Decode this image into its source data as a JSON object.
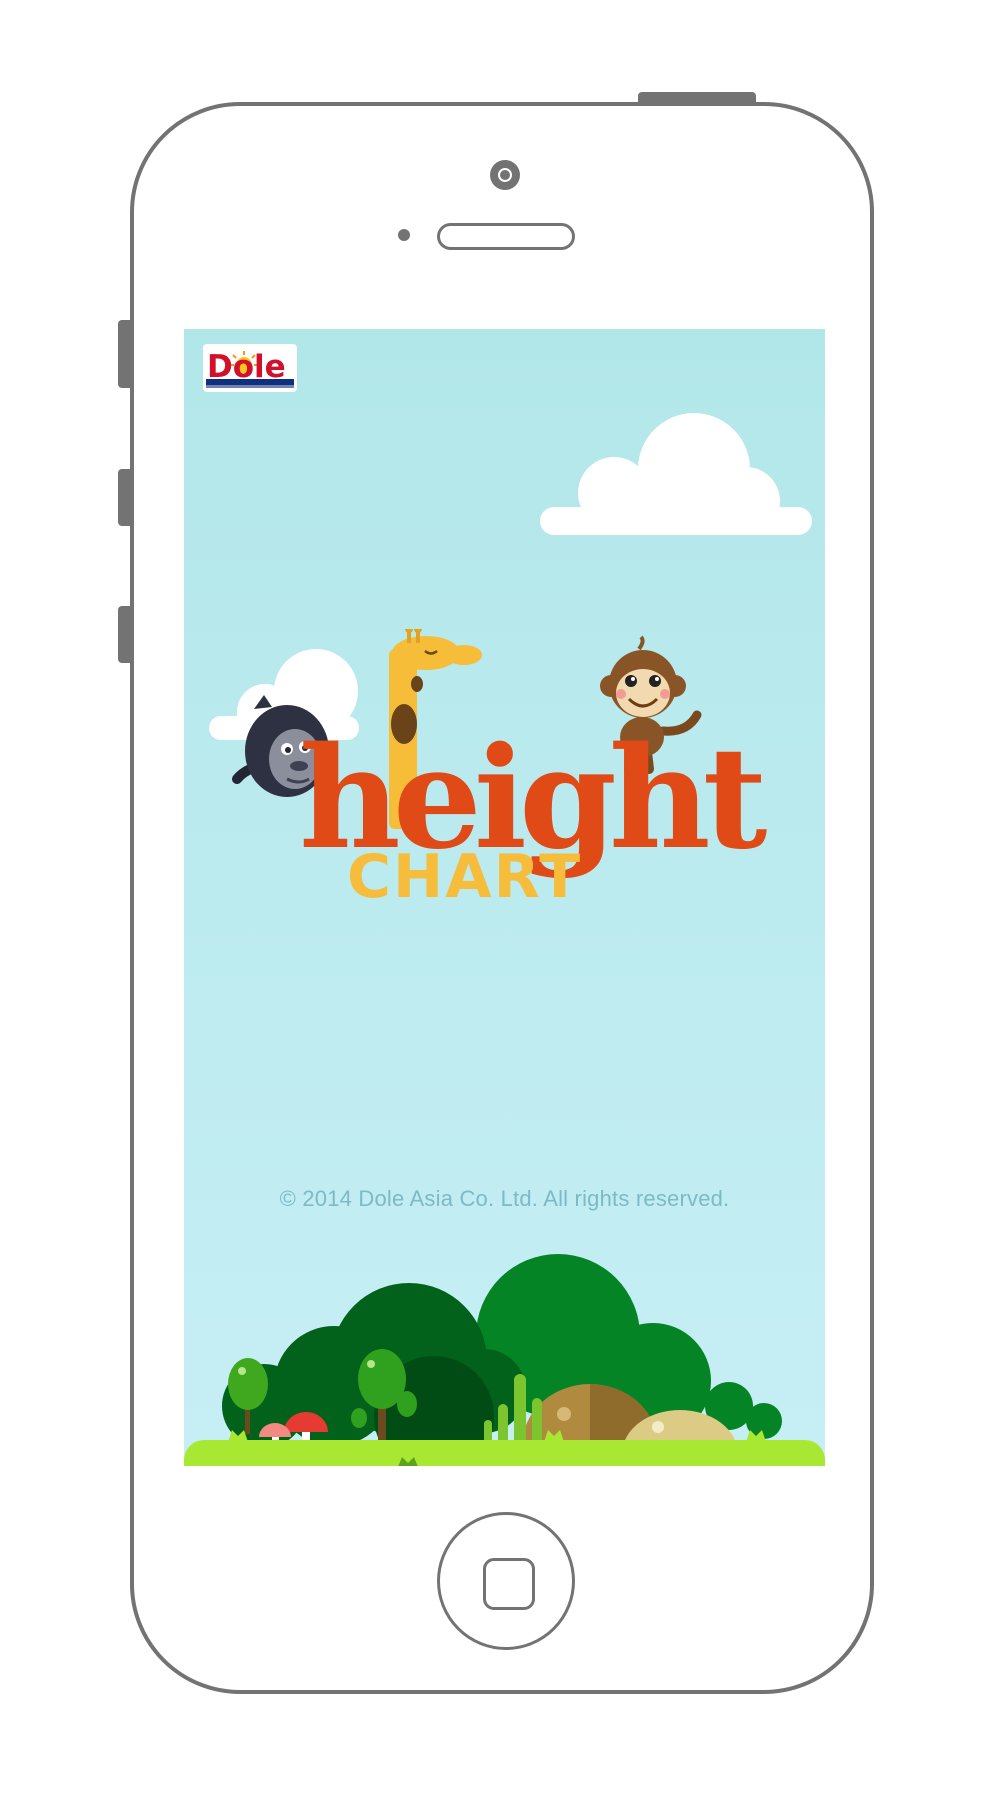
{
  "app": {
    "brand": "Dole",
    "title_word_1": "height",
    "title_word_2": "CHART",
    "copyright": "© 2014 Dole Asia Co. Ltd. All rights reserved."
  },
  "colors": {
    "sky_top": "#b2e7e9",
    "sky_bottom": "#c6eff5",
    "title_orange": "#e04a16",
    "chart_yellow": "#f6bd3c",
    "grass": "#a8e832",
    "phone_outline": "#737373",
    "dole_red": "#d3102b",
    "dole_blue": "#0f2f7f"
  }
}
